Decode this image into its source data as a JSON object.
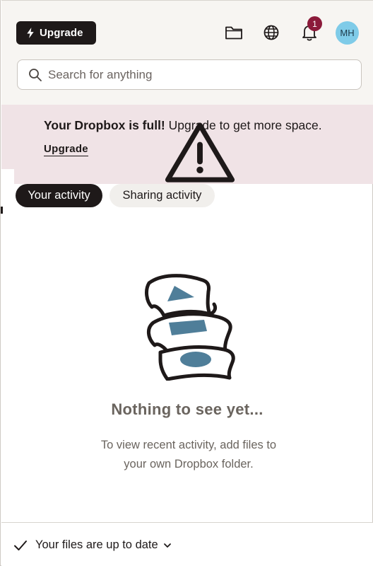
{
  "header": {
    "upgrade_label": "Upgrade",
    "notification_count": "1",
    "avatar_initials": "MH"
  },
  "search": {
    "placeholder": "Search for anything"
  },
  "banner": {
    "title": "Your Dropbox is full!",
    "message": " Upgrade to get more space.",
    "link_label": "Upgrade"
  },
  "tabs": [
    {
      "label": "Your activity",
      "active": true
    },
    {
      "label": "Sharing activity",
      "active": false
    }
  ],
  "empty_state": {
    "title": "Nothing to see yet...",
    "line1": "To view recent activity, add files to",
    "line2": "your own Dropbox folder."
  },
  "footer": {
    "status": "Your files are up to date"
  },
  "colors": {
    "dark": "#1e1919",
    "banner_bg": "#f0e3e6",
    "badge": "#8b1a3a",
    "avatar": "#7fcbe8",
    "illustration_fill": "#4f7e99"
  }
}
